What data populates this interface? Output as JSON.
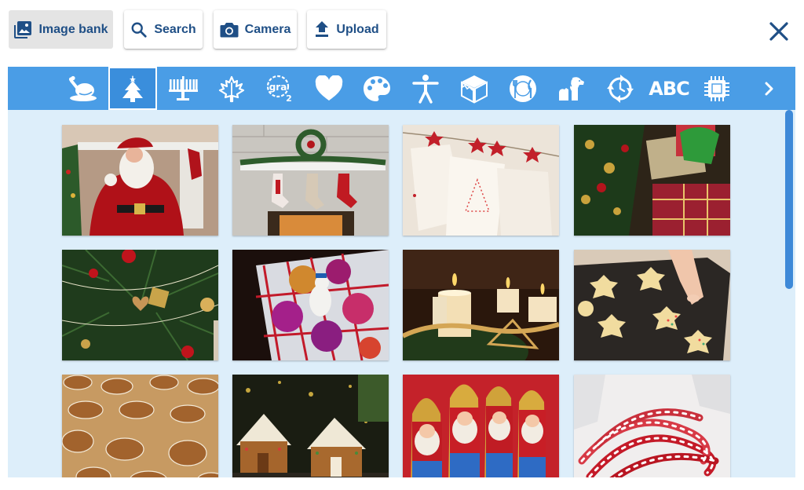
{
  "toolbar": {
    "image_bank_label": "Image bank",
    "search_label": "Search",
    "camera_label": "Camera",
    "upload_label": "Upload"
  },
  "categories": [
    {
      "name": "food",
      "icon": "roast-turkey-icon"
    },
    {
      "name": "christmas",
      "icon": "christmas-tree-icon",
      "selected": true
    },
    {
      "name": "hanukkah",
      "icon": "menorah-icon"
    },
    {
      "name": "autumn",
      "icon": "maple-leaf-icon"
    },
    {
      "name": "language",
      "icon": "language-bubble-icon"
    },
    {
      "name": "love",
      "icon": "heart-icon"
    },
    {
      "name": "arts",
      "icon": "palette-icon"
    },
    {
      "name": "people",
      "icon": "person-icon"
    },
    {
      "name": "objects",
      "icon": "cube-icon"
    },
    {
      "name": "eating",
      "icon": "plate-utensils-icon"
    },
    {
      "name": "animals",
      "icon": "dogs-icon"
    },
    {
      "name": "routines",
      "icon": "circular-arrows-icon"
    },
    {
      "name": "alphabet",
      "icon": "abc-icon",
      "text": "ABC"
    },
    {
      "name": "technology",
      "icon": "chip-icon"
    },
    {
      "name": "more",
      "icon": "chevron-right-icon"
    }
  ],
  "images": [
    {
      "subject": "santa-claus"
    },
    {
      "subject": "fireplace-stockings"
    },
    {
      "subject": "advent-calendar-bags"
    },
    {
      "subject": "wrapped-presents"
    },
    {
      "subject": "decorated-tree"
    },
    {
      "subject": "baubles-box"
    },
    {
      "subject": "advent-candles"
    },
    {
      "subject": "gingerbread-baking"
    },
    {
      "subject": "gingerbread-cookies"
    },
    {
      "subject": "gingerbread-houses"
    },
    {
      "subject": "chocolate-santas"
    },
    {
      "subject": "candy-canes"
    }
  ],
  "colors": {
    "accent": "#4a9de6",
    "content_bg": "#ddeefa",
    "button_text": "#1f4f86",
    "scrollbar": "#3e89d8"
  }
}
